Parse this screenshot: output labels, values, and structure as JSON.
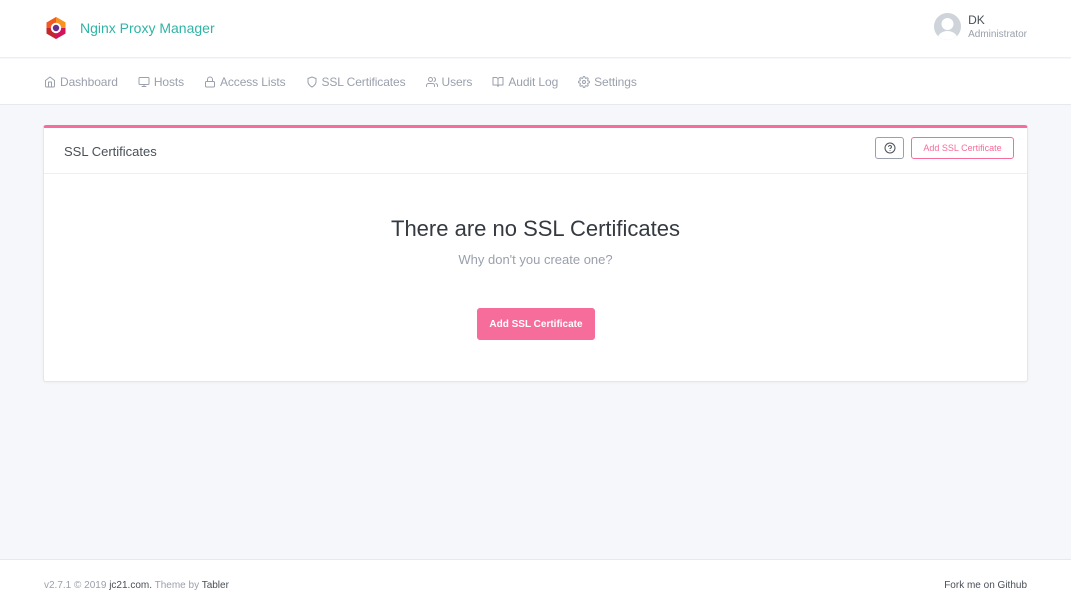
{
  "app": {
    "name": "Nginx Proxy Manager",
    "logo_icon": "nginx-proxy-manager-logo",
    "accent_color": "#f66d9b",
    "brand_color": "#2fb4a6"
  },
  "user": {
    "name": "DK",
    "role": "Administrator",
    "avatar_icon": "user-avatar-icon"
  },
  "nav": {
    "items": [
      {
        "label": "Dashboard",
        "icon": "home-icon"
      },
      {
        "label": "Hosts",
        "icon": "monitor-icon"
      },
      {
        "label": "Access Lists",
        "icon": "lock-icon"
      },
      {
        "label": "SSL Certificates",
        "icon": "shield-icon"
      },
      {
        "label": "Users",
        "icon": "users-icon"
      },
      {
        "label": "Audit Log",
        "icon": "book-open-icon"
      },
      {
        "label": "Settings",
        "icon": "settings-icon"
      }
    ]
  },
  "card": {
    "title": "SSL Certificates",
    "help_icon": "help-circle-icon",
    "add_button_label": "Add SSL Certificate",
    "empty_title": "There are no SSL Certificates",
    "empty_subtitle": "Why don't you create one?",
    "empty_add_button_label": "Add SSL Certificate"
  },
  "footer": {
    "version": "v2.7.1 © 2019",
    "company": "jc21.com.",
    "theme_prefix": "Theme by",
    "theme_name": "Tabler",
    "github_link": "Fork me on Github"
  }
}
